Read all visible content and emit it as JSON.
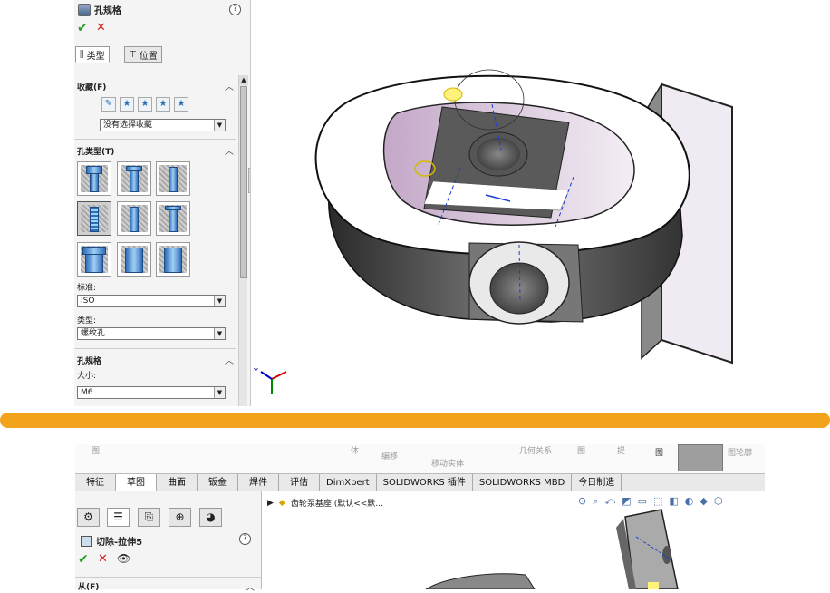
{
  "top": {
    "pm_title": "孔规格",
    "tabs": {
      "type": "类型",
      "position": "位置"
    },
    "favorites": {
      "title": "收藏(F)",
      "dropdown": "没有选择收藏"
    },
    "hole_type": {
      "title": "孔类型(T)"
    },
    "standard": {
      "label": "标准:",
      "value": "ISO"
    },
    "type": {
      "label": "类型:",
      "value": "螺纹孔"
    },
    "spec": {
      "title": "孔规格",
      "size_label": "大小:",
      "size_value": "M6"
    }
  },
  "bottom": {
    "ribbon_faded": [
      "图",
      "体",
      "编移",
      "移动实体",
      "几何关系",
      "图",
      "提",
      "图",
      "图轮廓"
    ],
    "command_tabs": [
      "特征",
      "草图",
      "曲面",
      "钣金",
      "焊件",
      "评估",
      "DimXpert",
      "SOLIDWORKS 插件",
      "SOLIDWORKS MBD",
      "今日制造"
    ],
    "active_tab_index": 1,
    "pm_title": "切除-拉伸5",
    "section_partial": "从(F)",
    "tree_item": "齿轮泵基座 (默认<<默..."
  },
  "colors": {
    "separator": "#f3a31b",
    "ok": "#2c9a2c",
    "cancel": "#d52020"
  }
}
